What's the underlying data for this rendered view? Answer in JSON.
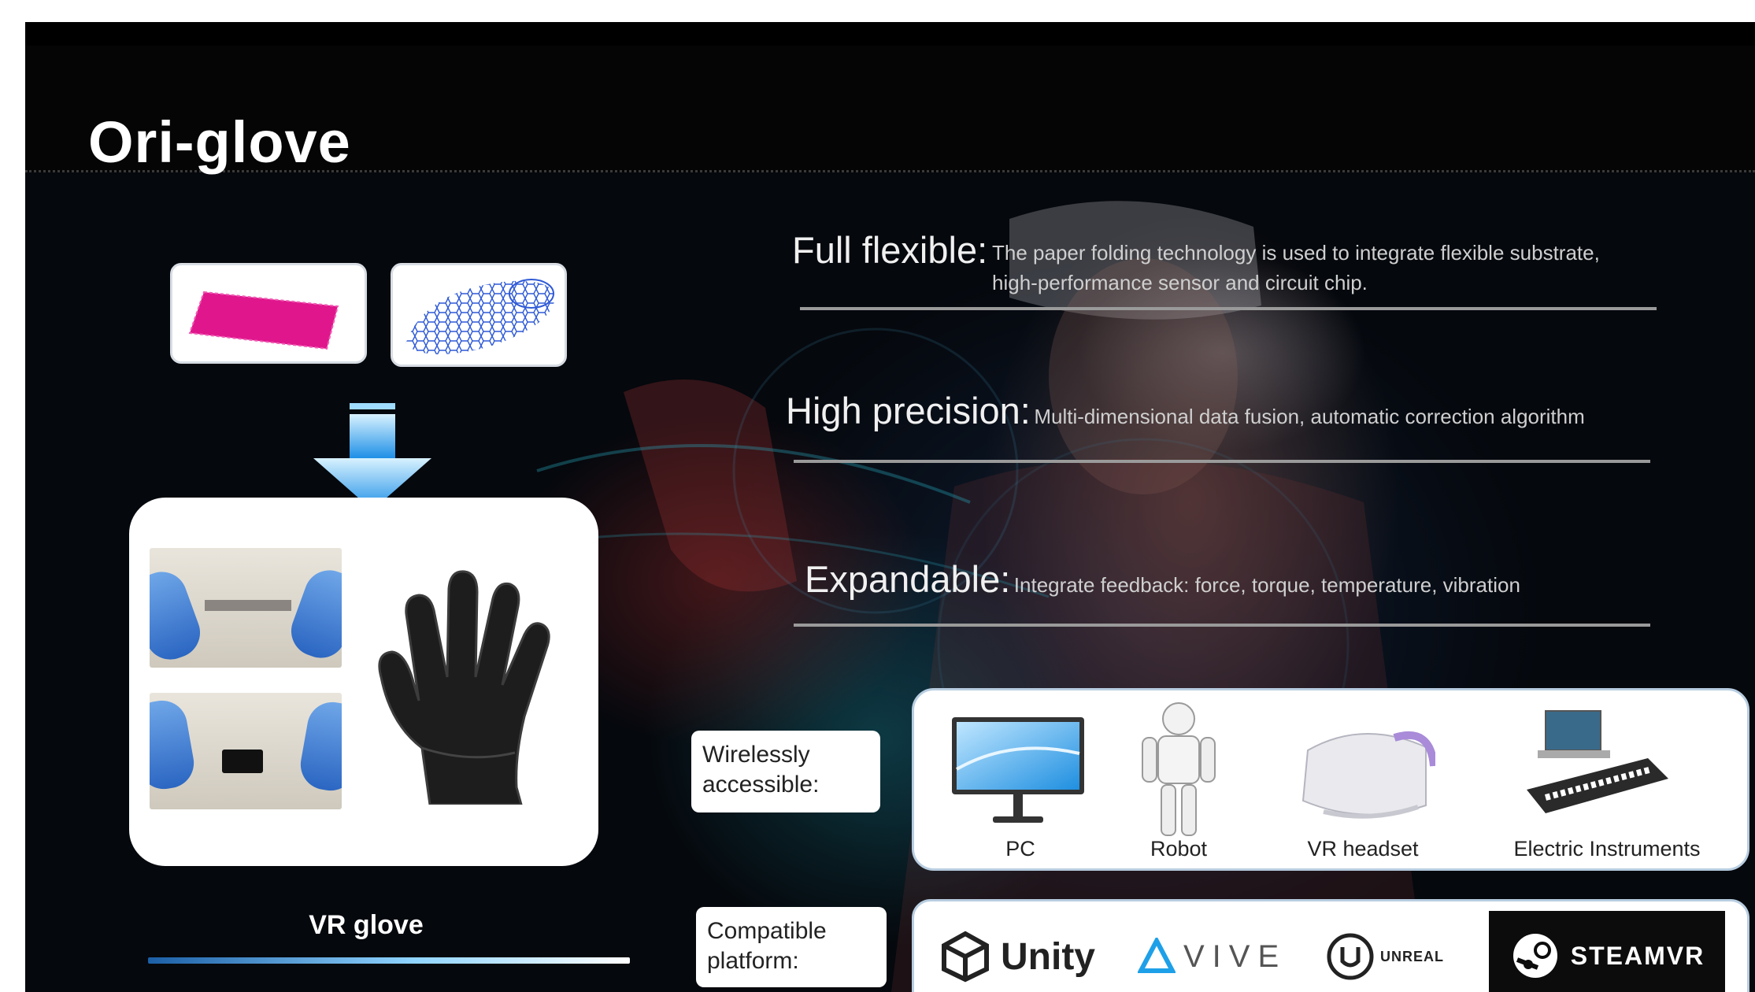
{
  "slide": {
    "title": "Ori-glove",
    "glove_label": "VR glove"
  },
  "features": [
    {
      "head": "Full flexible:",
      "desc_line1": "The paper folding technology is used to integrate flexible substrate,",
      "desc_line2": "high-performance sensor and circuit chip."
    },
    {
      "head": "High precision:",
      "desc": "Multi-dimensional data fusion, automatic correction algorithm"
    },
    {
      "head": "Expandable:",
      "desc": "Integrate feedback: force, torque, temperature, vibration"
    }
  ],
  "wireless": {
    "label_line1": "Wirelessly",
    "label_line2": "accessible:",
    "devices": [
      {
        "caption": "PC",
        "icon": "monitor-icon"
      },
      {
        "caption": "Robot",
        "icon": "robot-icon"
      },
      {
        "caption": "VR headset",
        "icon": "vr-headset-icon"
      },
      {
        "caption": "Electric Instruments",
        "icon": "keyboard-instrument-icon"
      }
    ]
  },
  "compatible": {
    "label_line1": "Compatible",
    "label_line2": "platform:",
    "platforms": {
      "unity": "Unity",
      "vive": "VIVE",
      "unreal": "UNREAL",
      "steam": "STEAMVR"
    }
  },
  "colors": {
    "background": "#000000",
    "accent_blue": "#3aa0f0",
    "material_pink": "#e0168c",
    "mesh_blue": "#2f5ad6"
  }
}
